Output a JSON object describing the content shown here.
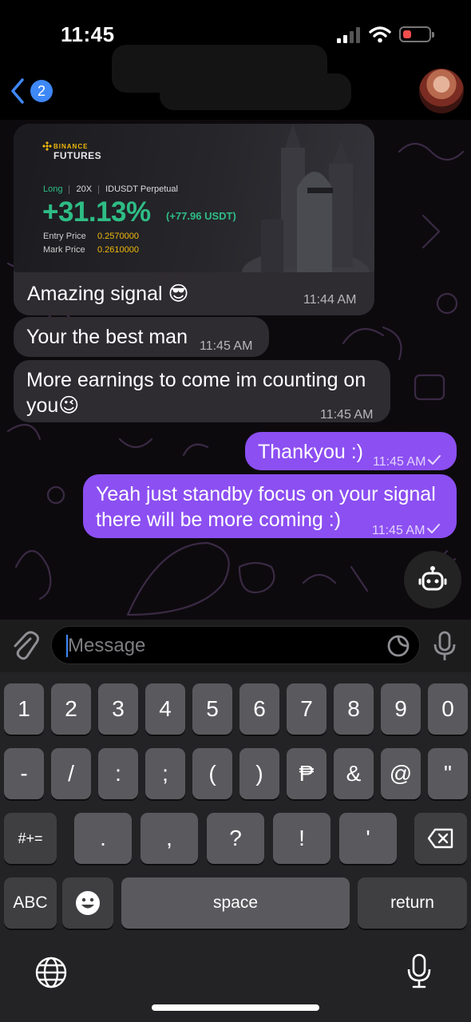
{
  "status_bar": {
    "time": "11:45",
    "battery_color": "#f24d4d"
  },
  "header": {
    "back_badge": "2",
    "back_icon": "chevron-left-icon",
    "avatar_icon": "contact-avatar"
  },
  "accent_color": "#8c4ff2",
  "messages": [
    {
      "direction": "incoming",
      "type": "image",
      "card": {
        "brand": "BINANCE",
        "product": "FUTURES",
        "side": "Long",
        "leverage": "20X",
        "pair": "IDUSDT Perpetual",
        "pnl_percent": "+31.13%",
        "pnl_usdt": "(+77.96 USDT)",
        "entry_label": "Entry Price",
        "entry_value": "0.2570000",
        "mark_label": "Mark Price",
        "mark_value": "0.2610000"
      },
      "text": "Amazing signal 😎",
      "time": "11:44 AM"
    },
    {
      "direction": "incoming",
      "text": "Your the best man",
      "time": "11:45 AM"
    },
    {
      "direction": "incoming",
      "text_line1": "More earnings to come im counting on",
      "text_line2": "you😉",
      "time": "11:45 AM"
    },
    {
      "direction": "outgoing",
      "text": "Thankyou :)",
      "time": "11:45 AM",
      "status": "read-check"
    },
    {
      "direction": "outgoing",
      "text_line1": "Yeah just standby focus on your signal",
      "text_line2": "there will be more coming :)",
      "time": "11:45 AM",
      "status": "read-check"
    }
  ],
  "bot_button_icon": "robot-icon",
  "composer": {
    "placeholder": "Message",
    "attach_icon": "paperclip-icon",
    "sticker_icon": "sticker-icon",
    "mic_icon": "mic-icon"
  },
  "keyboard": {
    "row1": [
      "1",
      "2",
      "3",
      "4",
      "5",
      "6",
      "7",
      "8",
      "9",
      "0"
    ],
    "row2": [
      "-",
      "/",
      ":",
      ";",
      "(",
      ")",
      "₱",
      "&",
      "@",
      "\""
    ],
    "row3_left": "#+=",
    "row3": [
      ".",
      ",",
      "?",
      "!",
      "'"
    ],
    "row3_right_icon": "backspace-icon",
    "abc": "ABC",
    "emoji_icon": "emoji-icon",
    "space": "space",
    "return": "return",
    "globe_icon": "globe-icon",
    "dictation_icon": "mic-icon"
  }
}
